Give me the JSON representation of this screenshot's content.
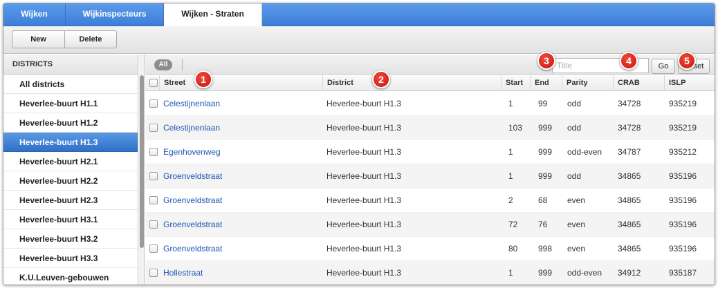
{
  "tabs": [
    {
      "label": "Wijken",
      "active": false
    },
    {
      "label": "Wijkinspecteurs",
      "active": false
    },
    {
      "label": "Wijken - Straten",
      "active": true
    }
  ],
  "toolbar": {
    "new_label": "New",
    "delete_label": "Delete"
  },
  "sidebar": {
    "title": "DISTRICTS",
    "items": [
      {
        "label": "All districts",
        "active": false
      },
      {
        "label": "Heverlee-buurt H1.1",
        "active": false
      },
      {
        "label": "Heverlee-buurt H1.2",
        "active": false
      },
      {
        "label": "Heverlee-buurt H1.3",
        "active": true
      },
      {
        "label": "Heverlee-buurt H2.1",
        "active": false
      },
      {
        "label": "Heverlee-buurt H2.2",
        "active": false
      },
      {
        "label": "Heverlee-buurt H2.3",
        "active": false
      },
      {
        "label": "Heverlee-buurt H3.1",
        "active": false
      },
      {
        "label": "Heverlee-buurt H3.2",
        "active": false
      },
      {
        "label": "Heverlee-buurt H3.3",
        "active": false
      },
      {
        "label": "K.U.Leuven-gebouwen",
        "active": false
      }
    ]
  },
  "filter": {
    "all_label": "All",
    "search_placeholder": "Title",
    "go_label": "Go",
    "reset_label": "Reset"
  },
  "table": {
    "columns": [
      "Street",
      "District",
      "Start",
      "End",
      "Parity",
      "CRAB",
      "ISLP"
    ],
    "rows": [
      [
        "Celestijnenlaan",
        "Heverlee-buurt H1.3",
        "1",
        "99",
        "odd",
        "34728",
        "935219"
      ],
      [
        "Celestijnenlaan",
        "Heverlee-buurt H1.3",
        "103",
        "999",
        "odd",
        "34728",
        "935219"
      ],
      [
        "Egenhovenweg",
        "Heverlee-buurt H1.3",
        "1",
        "999",
        "odd-even",
        "34787",
        "935212"
      ],
      [
        "Groenveldstraat",
        "Heverlee-buurt H1.3",
        "1",
        "999",
        "odd",
        "34865",
        "935196"
      ],
      [
        "Groenveldstraat",
        "Heverlee-buurt H1.3",
        "2",
        "68",
        "even",
        "34865",
        "935196"
      ],
      [
        "Groenveldstraat",
        "Heverlee-buurt H1.3",
        "72",
        "76",
        "even",
        "34865",
        "935196"
      ],
      [
        "Groenveldstraat",
        "Heverlee-buurt H1.3",
        "80",
        "998",
        "even",
        "34865",
        "935196"
      ],
      [
        "Hollestraat",
        "Heverlee-buurt H1.3",
        "1",
        "999",
        "odd-even",
        "34912",
        "935187"
      ]
    ]
  },
  "callouts": [
    "1",
    "2",
    "3",
    "4",
    "5"
  ],
  "colors": {
    "accent": "#3d7fd8",
    "link": "#1d56b4",
    "callout": "#d9241a",
    "selected": "#2f6fc7"
  }
}
